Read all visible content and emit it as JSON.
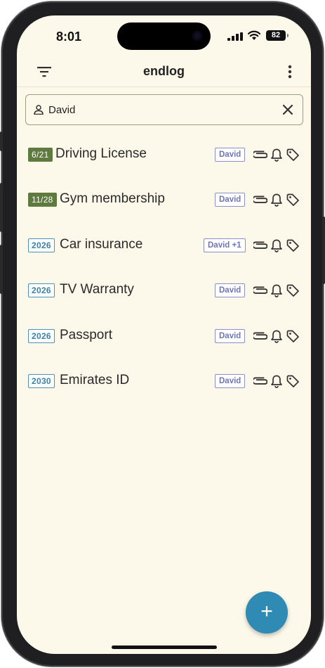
{
  "status": {
    "time": "8:01",
    "battery": "82"
  },
  "appbar": {
    "title": "endlog",
    "filter_icon": "filter-icon",
    "menu_icon": "more-vert-icon"
  },
  "search": {
    "value": "David",
    "icon": "person-icon",
    "clear_icon": "close-icon"
  },
  "items": [
    {
      "badge": "6/21",
      "badge_style": "solid",
      "name": "Driving License",
      "owner": "David"
    },
    {
      "badge": "11/28",
      "badge_style": "solid",
      "name": "Gym membership",
      "owner": "David"
    },
    {
      "badge": "2026",
      "badge_style": "outline",
      "name": "Car insurance",
      "owner": "David +1"
    },
    {
      "badge": "2026",
      "badge_style": "outline",
      "name": "TV Warranty",
      "owner": "David"
    },
    {
      "badge": "2026",
      "badge_style": "outline",
      "name": "Passport",
      "owner": "David"
    },
    {
      "badge": "2030",
      "badge_style": "outline",
      "name": "Emirates ID",
      "owner": "David"
    }
  ],
  "row_actions": [
    "attachment-icon",
    "bell-icon",
    "tag-icon"
  ],
  "fab": {
    "label": "+"
  },
  "colors": {
    "background": "#fcf8ea",
    "solid_badge": "#5e7a3e",
    "outline_badge": "#3a83a8",
    "owner_chip": "#6e76b8",
    "fab": "#2f8ab4"
  }
}
